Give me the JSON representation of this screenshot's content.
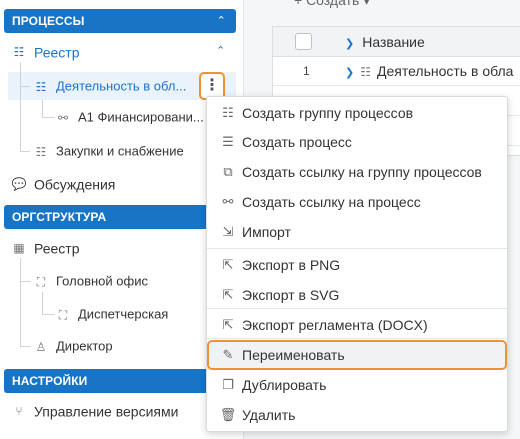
{
  "sidebar": {
    "processes_header": "ПРОЦЕССЫ",
    "registry": "Реестр",
    "activity_item": "Деятельность в обл...",
    "financing_item": "А1 Финансировани...",
    "procurement_item": "Закупки и снабжение",
    "discussions": "Обсуждения",
    "org_header": "ОРГСТРУКТУРА",
    "org_registry": "Реестр",
    "head_office": "Головной офис",
    "dispatch": "Диспетчерская",
    "director": "Директор",
    "settings_header": "НАСТРОЙКИ",
    "version_mgmt": "Управление версиями"
  },
  "table": {
    "create_btn": "+ Создать ▾",
    "column_name": "Название",
    "rows": [
      {
        "num": "1",
        "name": "Деятельность в обла"
      }
    ]
  },
  "menu": {
    "items": [
      {
        "label": "Создать группу процессов",
        "icon": "process-group-icon"
      },
      {
        "label": "Создать процесс",
        "icon": "process-icon"
      },
      {
        "label": "Создать ссылку на группу процессов",
        "icon": "group-link-icon"
      },
      {
        "label": "Создать ссылку на процесс",
        "icon": "process-link-icon"
      },
      {
        "label": "Импорт",
        "icon": "import-icon"
      },
      {
        "label": "Экспорт в PNG",
        "icon": "export-icon"
      },
      {
        "label": "Экспорт в SVG",
        "icon": "export-icon"
      },
      {
        "label": "Экспорт регламента (DOCX)",
        "icon": "export-icon"
      },
      {
        "label": "Переименовать",
        "icon": "rename-icon"
      },
      {
        "label": "Дублировать",
        "icon": "duplicate-icon"
      },
      {
        "label": "Удалить",
        "icon": "trash-icon"
      }
    ]
  },
  "colors": {
    "accent": "#1875c6",
    "highlight": "#f0922e"
  }
}
